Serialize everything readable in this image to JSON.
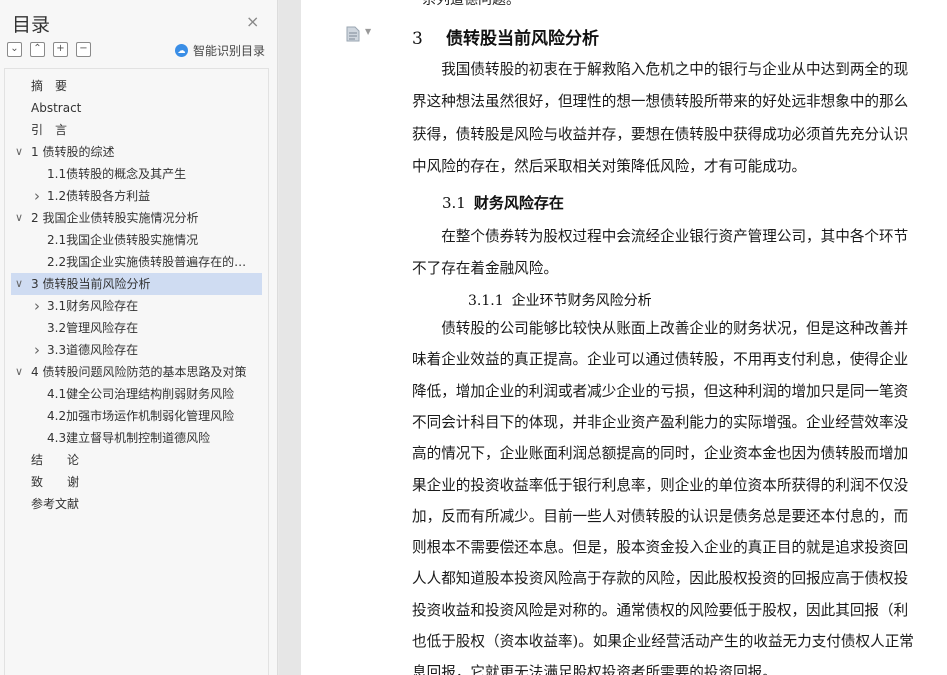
{
  "sidebar": {
    "title": "目录",
    "close_glyph": "×",
    "tools": {
      "collapse_all": "⌄",
      "expand_all": "⌃",
      "add": "+",
      "remove": "−"
    },
    "smart_label": "智能识别目录",
    "smart_icon": "cloud-icon",
    "items": [
      {
        "label": "摘　要",
        "level": 0,
        "chev": ""
      },
      {
        "label": "Abstract",
        "level": 0,
        "chev": ""
      },
      {
        "label": "引　言",
        "level": 0,
        "chev": ""
      },
      {
        "label": "1 债转股的综述",
        "level": 0,
        "chev": "down"
      },
      {
        "label": "1.1债转股的概念及其产生",
        "level": 1,
        "chev": ""
      },
      {
        "label": "1.2债转股各方利益",
        "level": 1,
        "chev": "right"
      },
      {
        "label": "2  我国企业债转股实施情况分析",
        "level": 0,
        "chev": "down"
      },
      {
        "label": "2.1我国企业债转股实施情况",
        "level": 1,
        "chev": ""
      },
      {
        "label": "2.2我国企业实施债转股普遍存在的问题",
        "level": 1,
        "chev": ""
      },
      {
        "label": "3  债转股当前风险分析",
        "level": 0,
        "chev": "down",
        "selected": true
      },
      {
        "label": "3.1财务风险存在",
        "level": 1,
        "chev": "right"
      },
      {
        "label": "3.2管理风险存在",
        "level": 1,
        "chev": ""
      },
      {
        "label": "3.3道德风险存在",
        "level": 1,
        "chev": "right"
      },
      {
        "label": "4  债转股问题风险防范的基本思路及对策",
        "level": 0,
        "chev": "down"
      },
      {
        "label": "4.1健全公司治理结构削弱财务风险",
        "level": 1,
        "chev": ""
      },
      {
        "label": "4.2加强市场运作机制弱化管理风险",
        "level": 1,
        "chev": ""
      },
      {
        "label": "4.3建立督导机制控制道德风险",
        "level": 1,
        "chev": ""
      },
      {
        "label": "结　　论",
        "level": 0,
        "chev": ""
      },
      {
        "label": "致　　谢",
        "level": 0,
        "chev": ""
      },
      {
        "label": "参考文献",
        "level": 0,
        "chev": ""
      }
    ]
  },
  "document": {
    "top_cut_text": "一系列道德问题。",
    "heading1": {
      "num": "3",
      "text": "债转股当前风险分析"
    },
    "para1": [
      "　　我国债转股的初衷在于解救陷入危机之中的银行与企业从中达到两全的现",
      "界这种想法虽然很好，但理性的想一想债转股所带来的好处远非想象中的那么",
      "获得，债转股是风险与收益并存，要想在债转股中获得成功必须首先充分认识",
      "中风险的存在，然后采取相关对策降低风险，才有可能成功。"
    ],
    "heading2": {
      "num": "3.1",
      "text": "财务风险存在"
    },
    "para2": [
      "　　在整个债券转为股权过程中会流经企业银行资产管理公司，其中各个环节",
      "不了存在着金融风险。"
    ],
    "heading3": {
      "num": "3.1.1",
      "text": "企业环节财务风险分析"
    },
    "para3": [
      "　　债转股的公司能够比较快从账面上改善企业的财务状况，但是这种改善并",
      "味着企业效益的真正提高。企业可以通过债转股，不用再支付利息，使得企业",
      "降低，增加企业的利润或者减少企业的亏损，但这种利润的增加只是同一笔资",
      "不同会计科目下的体现，并非企业资产盈利能力的实际增强。企业经营效率没",
      "高的情况下，企业账面利润总额提高的同时，企业资本金也因为债转股而增加",
      "果企业的投资收益率低于银行利息率，则企业的单位资本所获得的利润不仅没",
      "加，反而有所减少。目前一些人对债转股的认识是债务总是要还本付息的，而",
      "则根本不需要偿还本息。但是，股本资金投入企业的真正目的就是追求投资回",
      "人人都知道股本投资风险高于存款的风险，因此股权投资的回报应高于债权投",
      "投资收益和投资风险是对称的。通常债权的风险要低于股权，因此其回报（利",
      "也低于股权（资本收益率)。如果企业经营活动产生的收益无力支付债权人正常",
      "息回报，它就更无法满足股权投资者所需要的投资回报。"
    ]
  }
}
